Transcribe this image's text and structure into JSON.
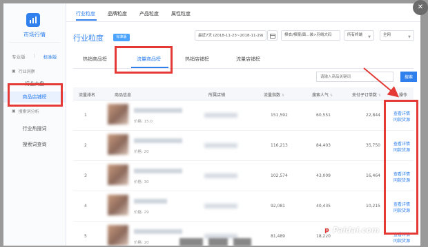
{
  "sidebar": {
    "app_title": "市场行情",
    "version_tabs": [
      "专业版",
      "标准版"
    ],
    "sections": [
      {
        "label": "行业洞察",
        "items": [
          "行业大盘",
          "商品店铺榜"
        ]
      },
      {
        "label": "搜索词分析",
        "items": [
          "行业热搜词",
          "搜索词查询"
        ]
      }
    ]
  },
  "header": {
    "top_tabs": [
      "行业粒度",
      "品牌粒度",
      "产品粒度",
      "属性粒度"
    ],
    "page_title": "行业粒度",
    "badge": "标准版",
    "date_range": "最近7天 (2018-11-23~2018-11-29)",
    "category": "棉衣/棉服/面...装>羽绒大码",
    "terminal": "所有终端",
    "region": "全网"
  },
  "sub_tabs": [
    "热销商品榜",
    "流量商品榜",
    "热销店铺榜",
    "流量店铺榜"
  ],
  "search": {
    "placeholder": "请输入商品关键词",
    "button": "搜索"
  },
  "table": {
    "headers": [
      "流量排名",
      "商品信息",
      "所属店铺",
      "流量指数",
      "搜索人气",
      "支付子订单数",
      "操作"
    ],
    "rows": [
      {
        "rank": "1",
        "price": "价格: 15.0",
        "traffic": "151,592",
        "search": "60,551",
        "orders": "22,844",
        "ops": [
          "查看详情",
          "同款货源"
        ]
      },
      {
        "rank": "2",
        "price": "价格: 20",
        "traffic": "116,213",
        "search": "84,403",
        "orders": "35,750",
        "ops": [
          "查看详情",
          "同款货源"
        ]
      },
      {
        "rank": "3",
        "price": "价格: 30",
        "traffic": "102,574",
        "search": "43,009",
        "orders": "16,464",
        "ops": [
          "查看详情",
          "同款货源"
        ]
      },
      {
        "rank": "4",
        "price": "价格: 29",
        "traffic": "92,081",
        "search": "40,435",
        "orders": "10,215",
        "ops": [
          "查看详情",
          "同款货源"
        ]
      },
      {
        "rank": "5",
        "price": "价格: 20",
        "traffic": "81,489",
        "search": "18,220",
        "orders": "",
        "ops": [
          "查看详情",
          "同款货源"
        ]
      }
    ]
  },
  "watermark": "Paidai.com",
  "colors": {
    "accent": "#2f80ed",
    "highlight": "#e53935"
  }
}
